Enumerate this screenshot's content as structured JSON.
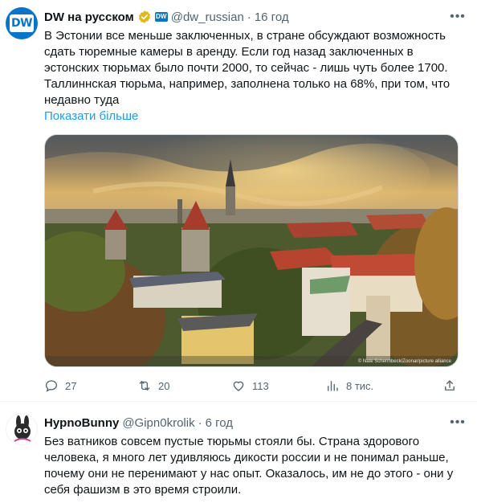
{
  "tweet1": {
    "author_name": "DW на русском",
    "handle": "@dw_russian",
    "dot": "·",
    "time": "16 год",
    "avatar_text": "DW",
    "badge_text": "DW",
    "text": "В Эстонии все меньше заключенных, в стране обсуждают возможность сдать тюремные камеры в аренду. Если год назад заключенных в эстонских тюрьмах было почти 2000, то сейчас - лишь чуть более 1700. Таллиннская тюрьма, например, заполнена только на 68%, при том, что недавно туда",
    "show_more": "Показати більше",
    "photo_credit": "© Nate Schermbeck/Zoonar/picture alliance",
    "actions": {
      "replies": "27",
      "retweets": "20",
      "likes": "113",
      "views": "8 тис."
    },
    "more_icon": "more-horizontal-icon"
  },
  "tweet2": {
    "author_name": "HypnoBunny",
    "handle": "@Gipn0krolik",
    "dot": "·",
    "time": "6 год",
    "text": "Без ватников совсем пустые тюрьмы стояли бы. Страна здорового человека, я много лет удивляюсь дикости россии и не понимал раньше, почему они не перенимают у нас опыт. Оказалось, им не до этого - они у себя фашизм в это время строили."
  },
  "colors": {
    "accent": "#1d9bf0",
    "verified_gold": "#e2b719",
    "dw_blue": "#0a74c9",
    "muted": "#536471"
  }
}
